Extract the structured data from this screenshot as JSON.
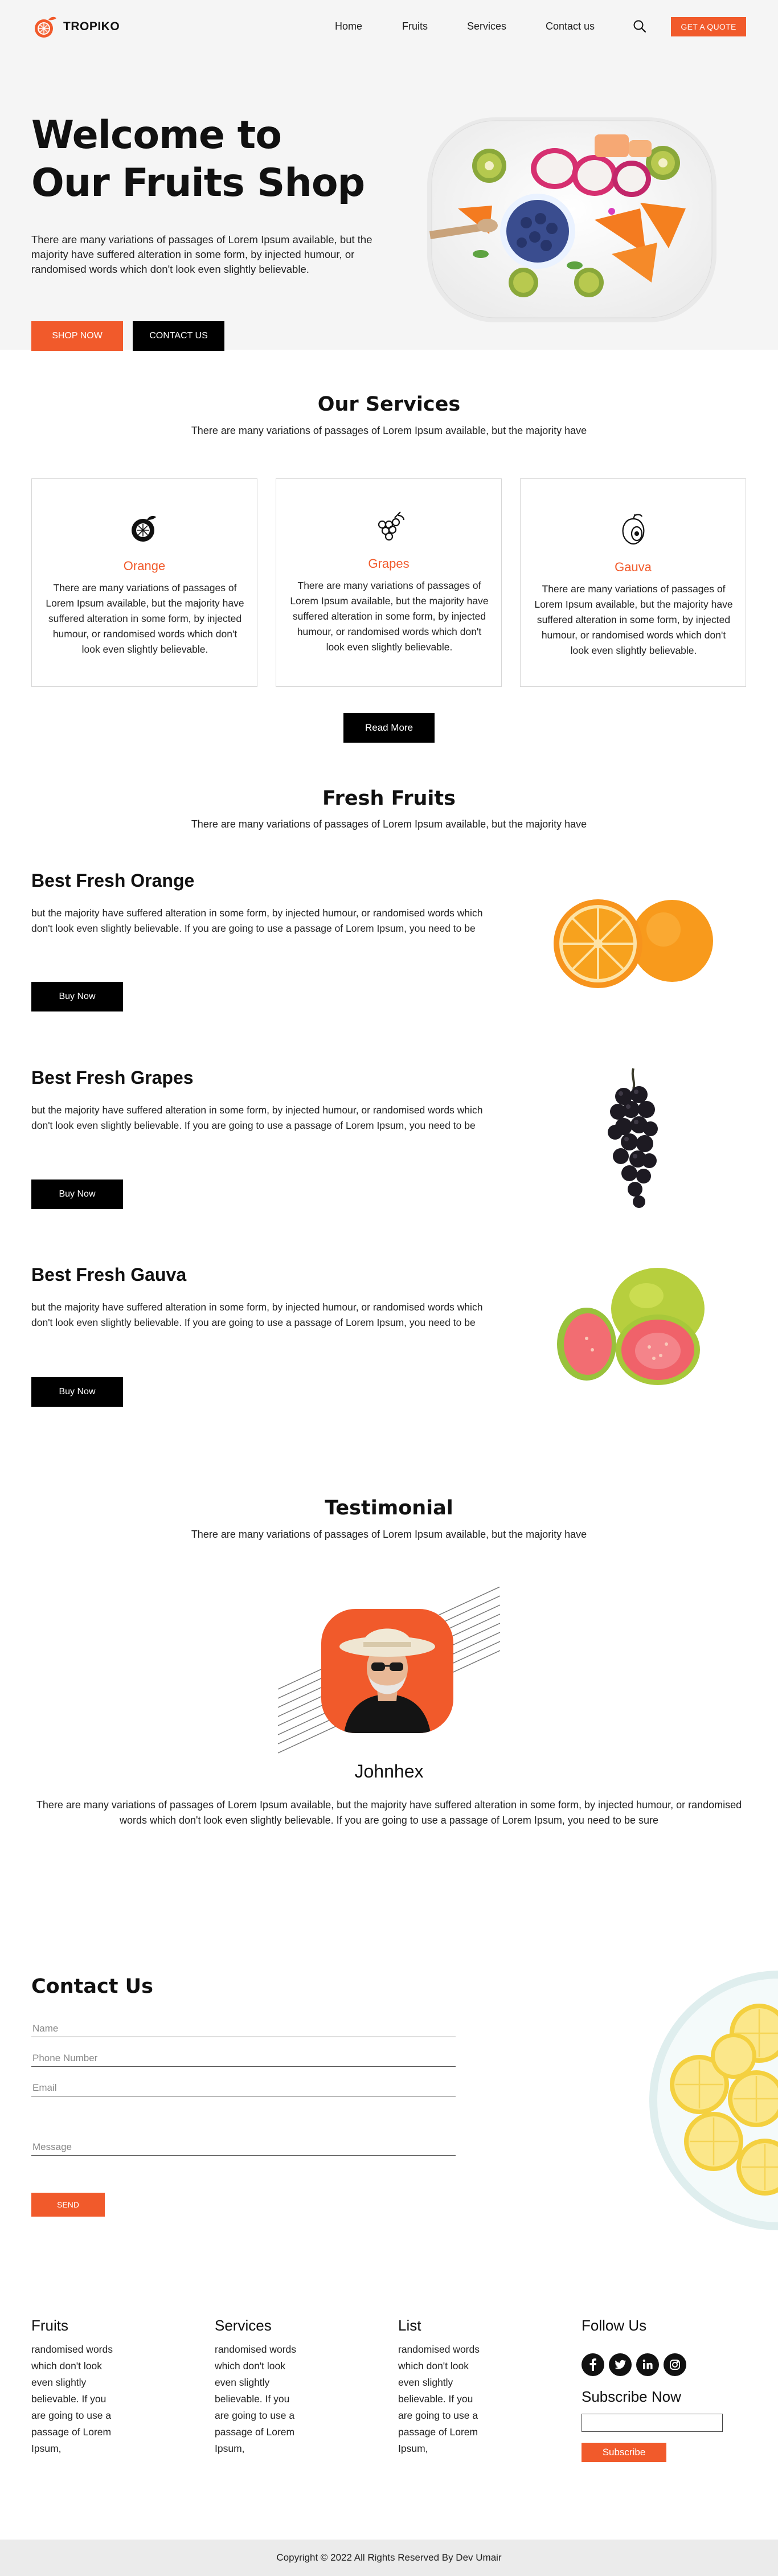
{
  "brand": {
    "name": "TROPIKO",
    "accent": "#f15a2b"
  },
  "nav": {
    "items": [
      "Home",
      "Fruits",
      "Services",
      "Contact us"
    ],
    "search_icon": "search-icon",
    "quote_label": "GET A QUOTE"
  },
  "hero": {
    "title_line1": "Welcome to",
    "title_line2": "Our Fruits Shop",
    "text": "There are many variations of passages of Lorem Ipsum available, but the majority have suffered alteration in some form, by injected humour, or randomised words which don't look even slightly believable.",
    "shop_label": "SHOP NOW",
    "contact_label": "CONTACT US"
  },
  "services": {
    "title": "Our Services",
    "subtitle": "There are many variations of passages of Lorem Ipsum available, but the majority have",
    "cards": [
      {
        "icon": "orange-icon",
        "title": "Orange",
        "text": "There are many variations of passages of Lorem Ipsum available, but the majority have suffered alteration in some form, by injected humour, or randomised words which don't look even slightly believable."
      },
      {
        "icon": "grapes-icon",
        "title": "Grapes",
        "text": "There are many variations of passages of Lorem Ipsum available, but the majority have suffered alteration in some form, by injected humour, or randomised words which don't look even slightly believable."
      },
      {
        "icon": "guava-icon",
        "title": "Gauva",
        "text": "There are many variations of passages of Lorem Ipsum available, but the majority have suffered alteration in some form, by injected humour, or randomised words which don't look even slightly believable."
      }
    ],
    "read_more_label": "Read More"
  },
  "fruits": {
    "title": "Fresh Fruits",
    "subtitle": "There are many variations of passages of Lorem Ipsum available, but the majority have",
    "items": [
      {
        "title": "Best Fresh Orange",
        "text": "but the majority have suffered alteration in some form, by injected humour, or randomised words which don't look even slightly believable. If you are going to use a passage of Lorem Ipsum, you need to be",
        "button": "Buy Now"
      },
      {
        "title": "Best Fresh Grapes",
        "text": "but the majority have suffered alteration in some form, by injected humour, or randomised words which don't look even slightly believable. If you are going to use a passage of Lorem Ipsum, you need to be",
        "button": "Buy Now"
      },
      {
        "title": "Best Fresh Gauva",
        "text": "but the majority have suffered alteration in some form, by injected humour, or randomised words which don't look even slightly believable. If you are going to use a passage of Lorem Ipsum, you need to be",
        "button": "Buy Now"
      }
    ]
  },
  "testimonial": {
    "title": "Testimonial",
    "subtitle": "There are many variations of passages of Lorem Ipsum available, but the majority have",
    "name": "Johnhex",
    "quote": "There are many variations of passages of Lorem Ipsum available, but the majority have suffered alteration in some form, by injected humour, or randomised words which don't look even slightly believable. If you are going to use a passage of Lorem Ipsum, you need to be sure"
  },
  "contact": {
    "title": "Contact Us",
    "name_placeholder": "Name",
    "phone_placeholder": "Phone Number",
    "email_placeholder": "Email",
    "message_placeholder": "Message",
    "send_label": "SEND"
  },
  "footer": {
    "columns": [
      {
        "title": "Fruits",
        "text": "randomised words which don't look even slightly believable. If you are going to use a passage of Lorem Ipsum,"
      },
      {
        "title": "Services",
        "text": "randomised words which don't look even slightly believable. If you are going to use a passage of Lorem Ipsum,"
      },
      {
        "title": "List",
        "text": "randomised words which don't look even slightly believable. If you are going to use a passage of Lorem Ipsum,"
      }
    ],
    "follow_title": "Follow Us",
    "social_icons": [
      "facebook-icon",
      "twitter-icon",
      "linkedin-icon",
      "instagram-icon"
    ],
    "subscribe_title": "Subscribe Now",
    "subscribe_label": "Subscribe",
    "copyright": "Copyright © 2022 All Rights Reserved By Dev Umair"
  }
}
